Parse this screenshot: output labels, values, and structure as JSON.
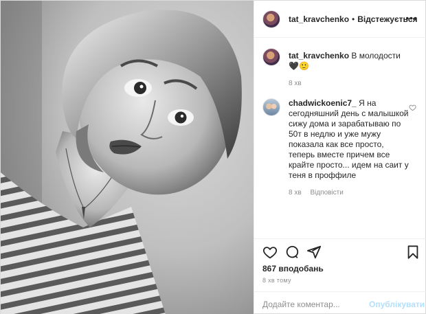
{
  "header": {
    "username": "tat_kravchenko",
    "separator": "•",
    "follow_state": "Відстежується"
  },
  "caption": {
    "username": "tat_kravchenko",
    "text": "В молодости 🖤🙂",
    "time": "8 хв"
  },
  "comments": [
    {
      "username": "chadwickoenic7_",
      "text": "Я на сегодняшний день с малышкой сижу дома и зарабатываю по 50т в недлю и уже мужу показала как все просто, теперь вместе причем все крайте просто... идем на саит у теня в проффиле",
      "time": "8 хв",
      "reply_label": "Відповісти"
    }
  ],
  "post": {
    "likes": "867 вподобань",
    "time_ago": "8 хв тому"
  },
  "comment_box": {
    "placeholder": "Додайте коментар...",
    "publish_label": "Опублікувати"
  },
  "icons": {
    "more": "more-options-icon",
    "like": "heart-icon",
    "comment": "comment-icon",
    "share": "share-icon",
    "save": "bookmark-icon"
  },
  "colors": {
    "text": "#262626",
    "secondary": "#8e8e8e",
    "border": "#dbdbdb",
    "publish_disabled": "#b2dffc"
  }
}
